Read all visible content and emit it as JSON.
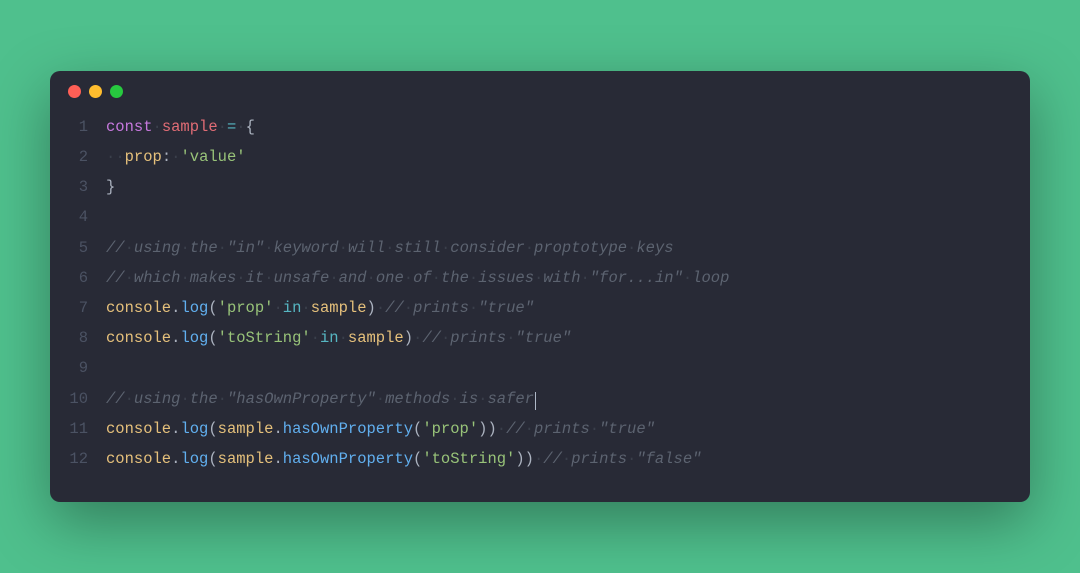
{
  "colors": {
    "page_bg": "#4fc08d",
    "window_bg": "#282a36",
    "gutter_fg": "#4b5263",
    "default_fg": "#abb2bf",
    "whitespace": "#3a3f4b",
    "keyword": "#c678dd",
    "ident": "#e06c75",
    "prop": "#e5c07b",
    "string": "#98c379",
    "operator": "#56b6c2",
    "comment": "#5c6370",
    "method": "#61afef",
    "traffic_red": "#ff5f56",
    "traffic_yellow": "#ffbd2e",
    "traffic_green": "#27c93f"
  },
  "traffic_lights": [
    "close",
    "minimize",
    "zoom"
  ],
  "lines": [
    {
      "num": "1",
      "tokens": [
        {
          "t": "keyword",
          "s": "const"
        },
        {
          "t": "ws",
          "s": "·"
        },
        {
          "t": "ident",
          "s": "sample"
        },
        {
          "t": "ws",
          "s": "·"
        },
        {
          "t": "op",
          "s": "="
        },
        {
          "t": "ws",
          "s": "·"
        },
        {
          "t": "punct",
          "s": "{"
        }
      ]
    },
    {
      "num": "2",
      "tokens": [
        {
          "t": "ws",
          "s": "·"
        },
        {
          "t": "ws",
          "s": "·"
        },
        {
          "t": "prop",
          "s": "prop"
        },
        {
          "t": "punct",
          "s": ":"
        },
        {
          "t": "ws",
          "s": "·"
        },
        {
          "t": "string",
          "s": "'value'"
        }
      ]
    },
    {
      "num": "3",
      "tokens": [
        {
          "t": "punct",
          "s": "}"
        }
      ]
    },
    {
      "num": "4",
      "tokens": []
    },
    {
      "num": "5",
      "tokens": [
        {
          "t": "comment",
          "s": "//"
        },
        {
          "t": "ws",
          "s": "·"
        },
        {
          "t": "comment",
          "s": "using"
        },
        {
          "t": "ws",
          "s": "·"
        },
        {
          "t": "comment",
          "s": "the"
        },
        {
          "t": "ws",
          "s": "·"
        },
        {
          "t": "comment",
          "s": "\"in\""
        },
        {
          "t": "ws",
          "s": "·"
        },
        {
          "t": "comment",
          "s": "keyword"
        },
        {
          "t": "ws",
          "s": "·"
        },
        {
          "t": "comment",
          "s": "will"
        },
        {
          "t": "ws",
          "s": "·"
        },
        {
          "t": "comment",
          "s": "still"
        },
        {
          "t": "ws",
          "s": "·"
        },
        {
          "t": "comment",
          "s": "consider"
        },
        {
          "t": "ws",
          "s": "·"
        },
        {
          "t": "comment",
          "s": "proptotype"
        },
        {
          "t": "ws",
          "s": "·"
        },
        {
          "t": "comment",
          "s": "keys"
        }
      ]
    },
    {
      "num": "6",
      "tokens": [
        {
          "t": "comment",
          "s": "//"
        },
        {
          "t": "ws",
          "s": "·"
        },
        {
          "t": "comment",
          "s": "which"
        },
        {
          "t": "ws",
          "s": "·"
        },
        {
          "t": "comment",
          "s": "makes"
        },
        {
          "t": "ws",
          "s": "·"
        },
        {
          "t": "comment",
          "s": "it"
        },
        {
          "t": "ws",
          "s": "·"
        },
        {
          "t": "comment",
          "s": "unsafe"
        },
        {
          "t": "ws",
          "s": "·"
        },
        {
          "t": "comment",
          "s": "and"
        },
        {
          "t": "ws",
          "s": "·"
        },
        {
          "t": "comment",
          "s": "one"
        },
        {
          "t": "ws",
          "s": "·"
        },
        {
          "t": "comment",
          "s": "of"
        },
        {
          "t": "ws",
          "s": "·"
        },
        {
          "t": "comment",
          "s": "the"
        },
        {
          "t": "ws",
          "s": "·"
        },
        {
          "t": "comment",
          "s": "issues"
        },
        {
          "t": "ws",
          "s": "·"
        },
        {
          "t": "comment",
          "s": "with"
        },
        {
          "t": "ws",
          "s": "·"
        },
        {
          "t": "comment",
          "s": "\"for...in\""
        },
        {
          "t": "ws",
          "s": "·"
        },
        {
          "t": "comment",
          "s": "loop"
        }
      ]
    },
    {
      "num": "7",
      "tokens": [
        {
          "t": "console",
          "s": "console"
        },
        {
          "t": "punct",
          "s": "."
        },
        {
          "t": "method",
          "s": "log"
        },
        {
          "t": "punct",
          "s": "("
        },
        {
          "t": "string",
          "s": "'prop'"
        },
        {
          "t": "ws",
          "s": "·"
        },
        {
          "t": "op",
          "s": "in"
        },
        {
          "t": "ws",
          "s": "·"
        },
        {
          "t": "param",
          "s": "sample"
        },
        {
          "t": "punct",
          "s": ")"
        },
        {
          "t": "ws",
          "s": "·"
        },
        {
          "t": "comment",
          "s": "//"
        },
        {
          "t": "ws",
          "s": "·"
        },
        {
          "t": "comment",
          "s": "prints"
        },
        {
          "t": "ws",
          "s": "·"
        },
        {
          "t": "comment",
          "s": "\"true\""
        }
      ]
    },
    {
      "num": "8",
      "tokens": [
        {
          "t": "console",
          "s": "console"
        },
        {
          "t": "punct",
          "s": "."
        },
        {
          "t": "method",
          "s": "log"
        },
        {
          "t": "punct",
          "s": "("
        },
        {
          "t": "string",
          "s": "'toString'"
        },
        {
          "t": "ws",
          "s": "·"
        },
        {
          "t": "op",
          "s": "in"
        },
        {
          "t": "ws",
          "s": "·"
        },
        {
          "t": "param",
          "s": "sample"
        },
        {
          "t": "punct",
          "s": ")"
        },
        {
          "t": "ws",
          "s": "·"
        },
        {
          "t": "comment",
          "s": "//"
        },
        {
          "t": "ws",
          "s": "·"
        },
        {
          "t": "comment",
          "s": "prints"
        },
        {
          "t": "ws",
          "s": "·"
        },
        {
          "t": "comment",
          "s": "\"true\""
        }
      ]
    },
    {
      "num": "9",
      "tokens": []
    },
    {
      "num": "10",
      "cursor_after": true,
      "tokens": [
        {
          "t": "comment",
          "s": "//"
        },
        {
          "t": "ws",
          "s": "·"
        },
        {
          "t": "comment",
          "s": "using"
        },
        {
          "t": "ws",
          "s": "·"
        },
        {
          "t": "comment",
          "s": "the"
        },
        {
          "t": "ws",
          "s": "·"
        },
        {
          "t": "comment",
          "s": "\"hasOwnProperty\""
        },
        {
          "t": "ws",
          "s": "·"
        },
        {
          "t": "comment",
          "s": "methods"
        },
        {
          "t": "ws",
          "s": "·"
        },
        {
          "t": "comment",
          "s": "is"
        },
        {
          "t": "ws",
          "s": "·"
        },
        {
          "t": "comment",
          "s": "safer"
        }
      ]
    },
    {
      "num": "11",
      "tokens": [
        {
          "t": "console",
          "s": "console"
        },
        {
          "t": "punct",
          "s": "."
        },
        {
          "t": "method",
          "s": "log"
        },
        {
          "t": "punct",
          "s": "("
        },
        {
          "t": "param",
          "s": "sample"
        },
        {
          "t": "punct",
          "s": "."
        },
        {
          "t": "method",
          "s": "hasOwnProperty"
        },
        {
          "t": "punct",
          "s": "("
        },
        {
          "t": "string",
          "s": "'prop'"
        },
        {
          "t": "punct",
          "s": "))"
        },
        {
          "t": "ws",
          "s": "·"
        },
        {
          "t": "comment",
          "s": "//"
        },
        {
          "t": "ws",
          "s": "·"
        },
        {
          "t": "comment",
          "s": "prints"
        },
        {
          "t": "ws",
          "s": "·"
        },
        {
          "t": "comment",
          "s": "\"true\""
        }
      ]
    },
    {
      "num": "12",
      "tokens": [
        {
          "t": "console",
          "s": "console"
        },
        {
          "t": "punct",
          "s": "."
        },
        {
          "t": "method",
          "s": "log"
        },
        {
          "t": "punct",
          "s": "("
        },
        {
          "t": "param",
          "s": "sample"
        },
        {
          "t": "punct",
          "s": "."
        },
        {
          "t": "method",
          "s": "hasOwnProperty"
        },
        {
          "t": "punct",
          "s": "("
        },
        {
          "t": "string",
          "s": "'toString'"
        },
        {
          "t": "punct",
          "s": "))"
        },
        {
          "t": "ws",
          "s": "·"
        },
        {
          "t": "comment",
          "s": "//"
        },
        {
          "t": "ws",
          "s": "·"
        },
        {
          "t": "comment",
          "s": "prints"
        },
        {
          "t": "ws",
          "s": "·"
        },
        {
          "t": "comment",
          "s": "\"false\""
        }
      ]
    }
  ]
}
